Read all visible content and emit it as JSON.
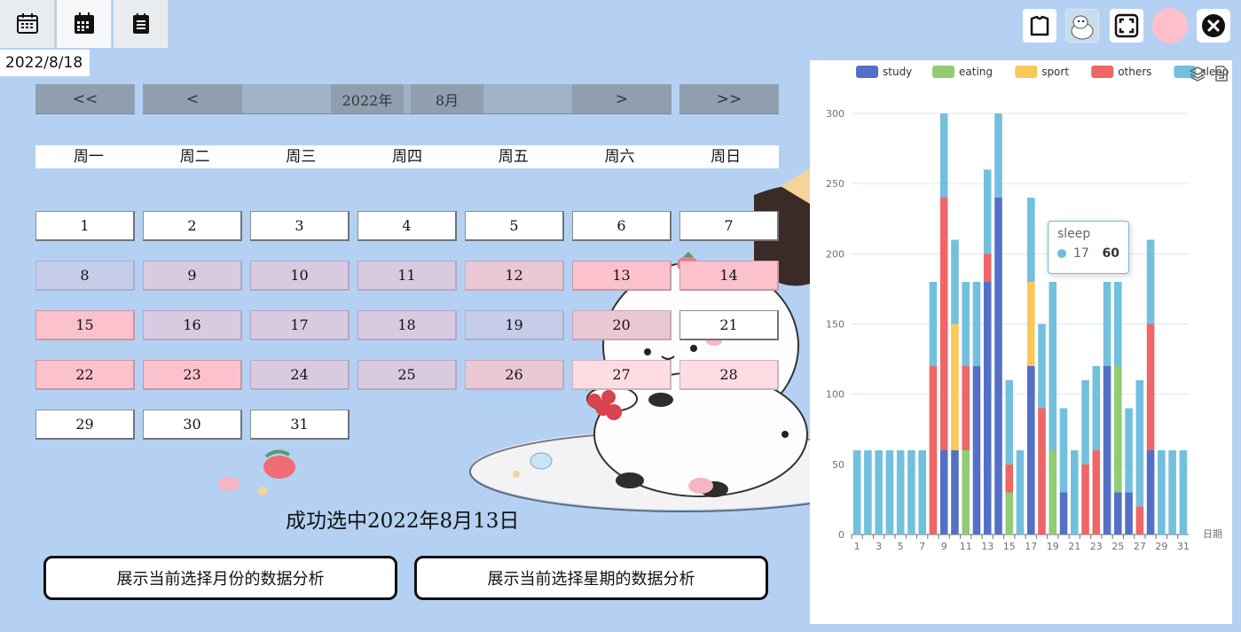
{
  "header": {
    "tabs": [
      {
        "icon": "calendar-icon"
      },
      {
        "icon": "calendar-grid-icon"
      },
      {
        "icon": "list-notes-icon"
      }
    ],
    "current_date": "2022/8/18"
  },
  "nav": {
    "prev_year": "<<",
    "prev_month": "<",
    "year": "2022年",
    "month": "8月",
    "next_month": ">",
    "next_year": ">>"
  },
  "weekdays": [
    "周一",
    "周二",
    "周三",
    "周四",
    "周五",
    "周六",
    "周日"
  ],
  "days": [
    "1",
    "2",
    "3",
    "4",
    "5",
    "6",
    "7",
    "8",
    "9",
    "10",
    "11",
    "12",
    "13",
    "14",
    "15",
    "16",
    "17",
    "18",
    "19",
    "20",
    "21",
    "22",
    "23",
    "24",
    "25",
    "26",
    "27",
    "28",
    "29",
    "30",
    "31"
  ],
  "status_text": "成功选中2022年8月13日",
  "buttons": {
    "month_analysis": "展示当前选择月份的数据分析",
    "week_analysis": "展示当前选择星期的数据分析"
  },
  "toolbar": {
    "icons": [
      "shirt-icon",
      "image-thumbnail-icon",
      "fullscreen-icon",
      "avatar-icon",
      "close-icon"
    ]
  },
  "colors": {
    "study": "#5470c6",
    "eating": "#91cc75",
    "sport": "#fac858",
    "others": "#ee6666",
    "sleep": "#73c0de"
  },
  "chart_data": {
    "type": "bar",
    "stacked": true,
    "xlabel": "日期",
    "ylim": [
      0,
      300
    ],
    "yticks": [
      0,
      50,
      100,
      150,
      200,
      250,
      300
    ],
    "categories": [
      "1",
      "2",
      "3",
      "4",
      "5",
      "6",
      "7",
      "8",
      "9",
      "10",
      "11",
      "12",
      "13",
      "14",
      "15",
      "16",
      "17",
      "18",
      "19",
      "20",
      "21",
      "22",
      "23",
      "24",
      "25",
      "26",
      "27",
      "28",
      "29",
      "30",
      "31"
    ],
    "xtick_labels": [
      "1",
      "3",
      "5",
      "7",
      "9",
      "11",
      "13",
      "15",
      "17",
      "19",
      "21",
      "23",
      "25",
      "27",
      "29",
      "31"
    ],
    "series": [
      {
        "name": "study",
        "values": [
          0,
          0,
          0,
          0,
          0,
          0,
          0,
          0,
          60,
          60,
          0,
          120,
          180,
          240,
          0,
          0,
          120,
          0,
          0,
          30,
          0,
          0,
          0,
          120,
          30,
          30,
          0,
          60,
          0,
          0,
          0
        ]
      },
      {
        "name": "eating",
        "values": [
          0,
          0,
          0,
          0,
          0,
          0,
          0,
          0,
          0,
          0,
          60,
          0,
          0,
          0,
          30,
          0,
          0,
          0,
          60,
          0,
          0,
          0,
          0,
          0,
          90,
          0,
          0,
          0,
          0,
          0,
          0
        ]
      },
      {
        "name": "sport",
        "values": [
          0,
          0,
          0,
          0,
          0,
          0,
          0,
          0,
          0,
          90,
          0,
          0,
          0,
          0,
          0,
          0,
          60,
          0,
          0,
          0,
          0,
          0,
          0,
          0,
          0,
          0,
          0,
          0,
          0,
          0,
          0
        ]
      },
      {
        "name": "others",
        "values": [
          0,
          0,
          0,
          0,
          0,
          0,
          0,
          120,
          180,
          0,
          60,
          0,
          20,
          0,
          20,
          0,
          0,
          90,
          0,
          0,
          0,
          50,
          60,
          0,
          0,
          0,
          20,
          90,
          0,
          0,
          0
        ]
      },
      {
        "name": "sleep",
        "values": [
          60,
          60,
          60,
          60,
          60,
          60,
          60,
          60,
          60,
          60,
          60,
          60,
          60,
          60,
          60,
          60,
          60,
          60,
          120,
          60,
          60,
          60,
          60,
          60,
          60,
          60,
          90,
          60,
          60,
          60,
          60
        ]
      }
    ],
    "legend": [
      "study",
      "eating",
      "sport",
      "others",
      "sleep"
    ],
    "legend_position": "top",
    "grid": true,
    "tooltip": {
      "series": "sleep",
      "x": "17",
      "value": "60"
    }
  }
}
